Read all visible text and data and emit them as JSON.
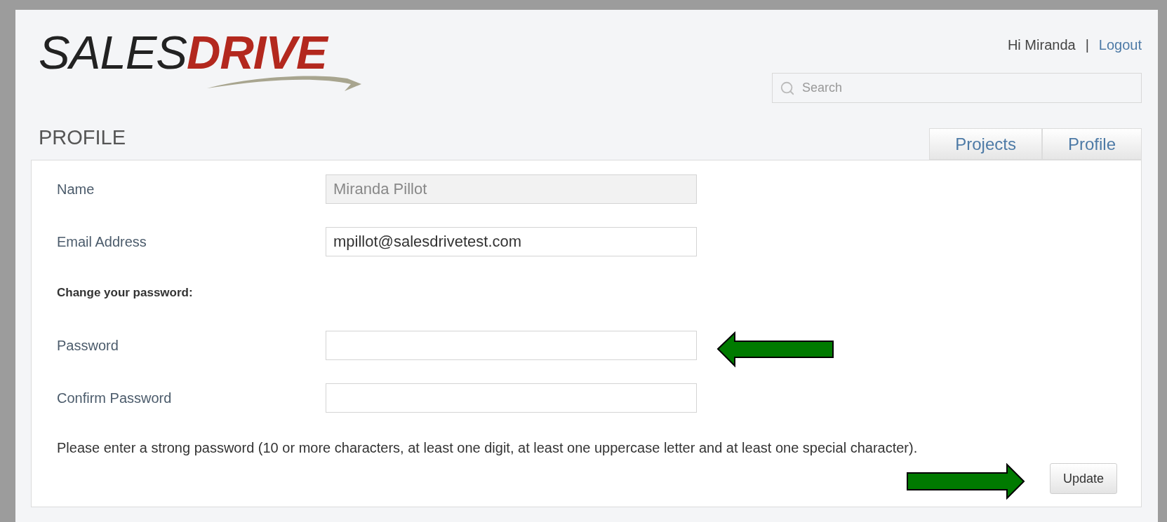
{
  "logo": {
    "part_1": "SALES",
    "part_2": "DRIVE"
  },
  "header": {
    "greeting": "Hi Miranda",
    "separator": "|",
    "logout": "Logout"
  },
  "search": {
    "placeholder": "Search"
  },
  "page_title": "PROFILE",
  "tabs": [
    {
      "label": "Projects",
      "selected": false
    },
    {
      "label": "Profile",
      "selected": false
    }
  ],
  "form": {
    "fields": [
      {
        "kind": "field",
        "label": "Name",
        "value": "Miranda Pillot",
        "disabled": true
      },
      {
        "kind": "field",
        "label": "Email Address",
        "value": "mpillot@salesdrivetest.com",
        "disabled": false
      },
      {
        "kind": "heading",
        "label": "Change your password:"
      },
      {
        "kind": "field",
        "label": "Password",
        "disabled": false
      },
      {
        "kind": "field",
        "label": "Confirm Password",
        "disabled": false
      }
    ],
    "help_text": "Please enter a strong password (10 or more characters, at least one digit, at least one uppercase letter and at least one special character).",
    "button": "Update"
  }
}
